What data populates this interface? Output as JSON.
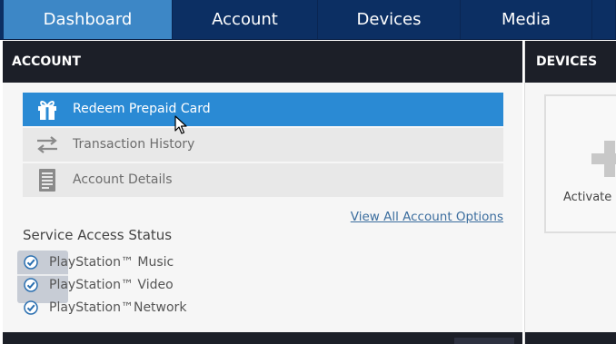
{
  "topnav": {
    "tabs": [
      {
        "label": "Dashboard",
        "active": true
      },
      {
        "label": "Account",
        "active": false
      },
      {
        "label": "Devices",
        "active": false
      },
      {
        "label": "Media",
        "active": false
      }
    ]
  },
  "account": {
    "header": "ACCOUNT",
    "menu": [
      {
        "label": "Redeem Prepaid Card",
        "icon": "gift-icon",
        "highlighted": true
      },
      {
        "label": "Transaction History",
        "icon": "swap-arrows-icon",
        "highlighted": false
      },
      {
        "label": "Account Details",
        "icon": "document-icon",
        "highlighted": false
      }
    ],
    "view_all_label": "View All Account Options",
    "service_status": {
      "title": "Service Access Status",
      "items": [
        {
          "label": "PlayStation™ Music",
          "checked": true
        },
        {
          "label": "PlayStation™ Video",
          "checked": true
        },
        {
          "label": "PlayStation™Network",
          "checked": true
        }
      ]
    }
  },
  "devices": {
    "header": "DEVICES",
    "card_label": "Activate a"
  },
  "colors": {
    "nav_bg": "#0c2f63",
    "nav_active": "#3d87c6",
    "header_bg": "#1c1f28",
    "highlight": "#2a8ad4",
    "link": "#3b6d9e"
  }
}
